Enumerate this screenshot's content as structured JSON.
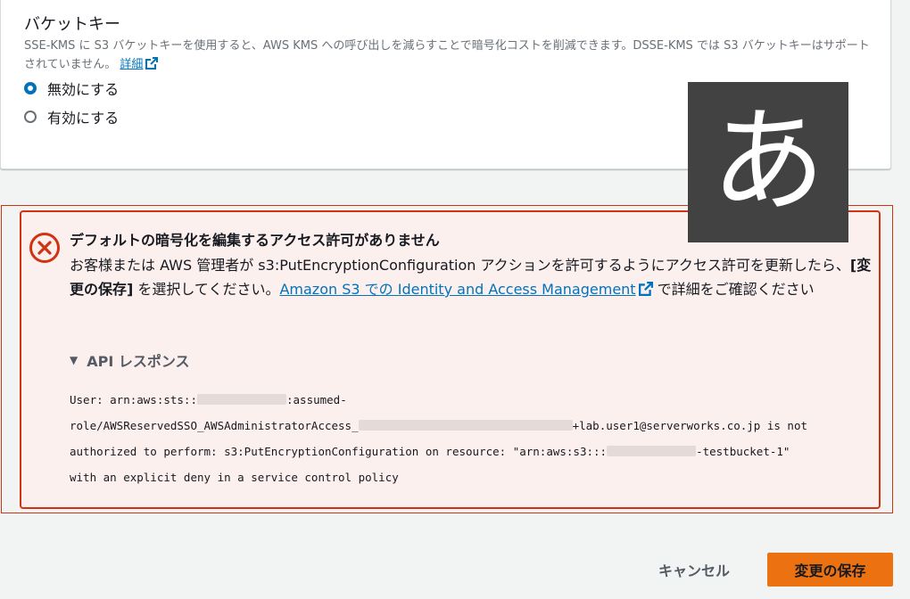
{
  "bucket_key": {
    "heading": "バケットキー",
    "description": "SSE-KMS に S3 バケットキーを使用すると、AWS KMS への呼び出しを減らすことで暗号化コストを削減できます。DSSE-KMS では S3 バケットキーはサポートされていません。",
    "details_link": "詳細",
    "options": [
      {
        "label": "無効にする",
        "checked": true
      },
      {
        "label": "有効にする",
        "checked": false
      }
    ]
  },
  "ime_indicator": "あ",
  "alert": {
    "title": "デフォルトの暗号化を編集するアクセス許可がありません",
    "body_part1": "お客様または AWS 管理者が s3:PutEncryptionConfiguration アクションを許可するようにアクセス許可を更新したら、",
    "body_bold": "[変更の保存]",
    "body_part2": " を選択してください。",
    "body_link": "Amazon S3 での Identity and Access Management",
    "body_part3": " で詳細をご確認ください",
    "api_toggle": "API レスポンス",
    "api_lines": [
      {
        "a": "User: arn:aws:sts::",
        "b": ":assumed-"
      },
      {
        "a": "role/AWSReservedSSO_AWSAdministratorAccess_",
        "b": "+lab.user1@serverworks.co.jp is not"
      },
      {
        "a": "authorized to perform: s3:PutEncryptionConfiguration on resource: \"arn:aws:s3:::",
        "b": "-testbucket-1\""
      },
      {
        "a": "with an explicit deny in a service control policy",
        "b": ""
      }
    ]
  },
  "buttons": {
    "cancel": "キャンセル",
    "save": "変更の保存"
  },
  "colors": {
    "error": "#d13212",
    "link": "#0073bb",
    "primary": "#ec7211"
  }
}
